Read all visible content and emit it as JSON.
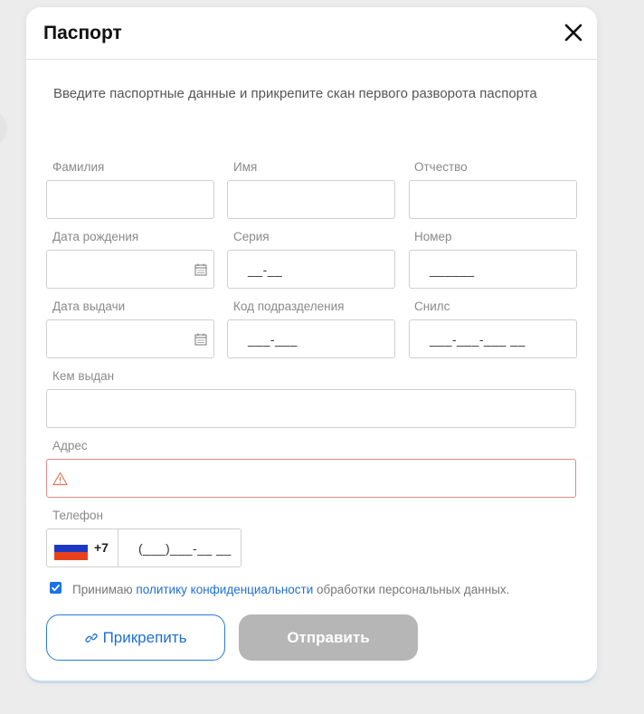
{
  "modal": {
    "title": "Паспорт",
    "intro": "Введите паспортные данные и прикрепите скан первого разворота паспорта"
  },
  "fields": {
    "surname": {
      "label": "Фамилия",
      "value": ""
    },
    "name": {
      "label": "Имя",
      "value": ""
    },
    "patronymic": {
      "label": "Отчество",
      "value": ""
    },
    "birth_date": {
      "label": "Дата рождения",
      "value": ""
    },
    "series": {
      "label": "Серия",
      "mask": "__-__"
    },
    "number": {
      "label": "Номер",
      "mask": "______"
    },
    "issue_date": {
      "label": "Дата выдачи",
      "value": ""
    },
    "division_code": {
      "label": "Код подразделения",
      "mask": "___-___"
    },
    "snils": {
      "label": "Снилс",
      "mask": "___-___-___ __"
    },
    "issued_by": {
      "label": "Кем выдан",
      "value": ""
    },
    "address": {
      "label": "Адрес",
      "value": "",
      "state": "error"
    },
    "phone": {
      "label": "Телефон",
      "prefix": "+7",
      "mask": "(___)___-__ __",
      "country_flag": "russia-flag-icon"
    }
  },
  "consent": {
    "checked": true,
    "text_before": "Принимаю ",
    "link_text": "политику конфиденциальности",
    "text_after": " обработки персональных данных."
  },
  "buttons": {
    "attach_label": "Прикрепить",
    "attach_icon": "link-icon",
    "send_label": "Отправить"
  },
  "colors": {
    "accent": "#1f6fd1",
    "error_border": "#e38a8a",
    "disabled_button": "#b6b6b6"
  }
}
